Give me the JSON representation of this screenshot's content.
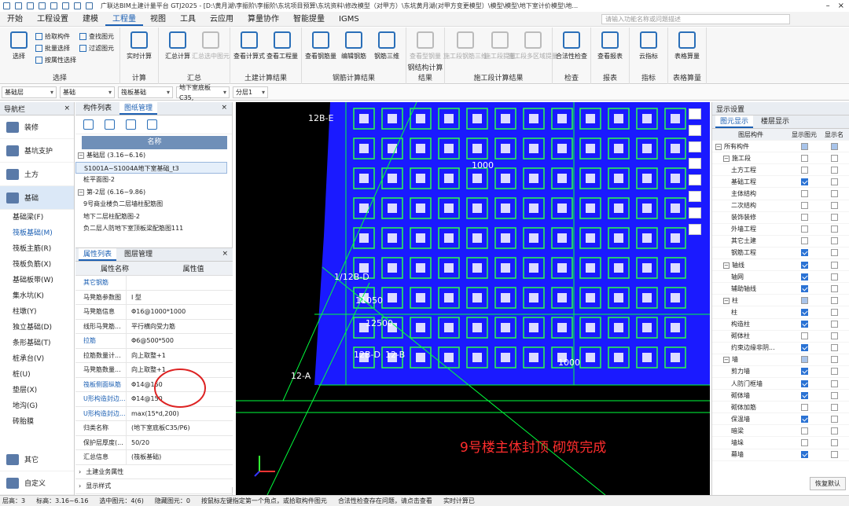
{
  "app": {
    "title": "广联达BIM土建计量平台 GTJ2025 - [D:\\黄月湖\\李振阶\\李振阶\\东坑项目预算\\东坑资料\\修改模型（对甲方）\\东坑黄月湖(对甲方变更模型）\\模型\\模型\\地下室计价模型\\地..."
  },
  "menu": [
    "开始",
    "工程设置",
    "建模",
    "工程量",
    "视图",
    "工具",
    "云应用",
    "算量协作",
    "智能提量",
    "IGMS"
  ],
  "search_placeholder": "请输入功能名称或问题描述",
  "ribbon": {
    "groups": [
      {
        "label": "选择",
        "big": [
          "选择"
        ],
        "small": [
          [
            "拾取构件",
            "批量选择",
            "按属性选择"
          ],
          [
            "查找图元",
            "过滤图元"
          ]
        ]
      },
      {
        "label": "计算",
        "big": [
          "实时计算"
        ]
      },
      {
        "label": "汇总",
        "big": [
          "汇总计算",
          "汇总选中图元"
        ],
        "dis": [
          false,
          true
        ]
      },
      {
        "label": "土建计算结果",
        "big": [
          "查看计算式",
          "查看工程量"
        ]
      },
      {
        "label": "钢筋计算结果",
        "big": [
          "查看钢筋量",
          "编辑钢筋",
          "钢筋三维"
        ]
      },
      {
        "label": "钢结构计算结果",
        "big": [
          "查看型钢量"
        ],
        "dis": [
          true
        ]
      },
      {
        "label": "施工段计算结果",
        "big": [
          "施工段钢筋三维",
          "施工段提量",
          "施工段多区域提量"
        ],
        "dis": [
          true,
          true,
          true
        ]
      },
      {
        "label": "检查",
        "big": [
          "合法性检查"
        ]
      },
      {
        "label": "报表",
        "big": [
          "查看报表"
        ]
      },
      {
        "label": "指标",
        "big": [
          "云指标"
        ]
      },
      {
        "label": "表格算量",
        "big": [
          "表格算量"
        ]
      }
    ]
  },
  "toolbar2": [
    "基础层",
    "基础",
    "筏板基础",
    "地下室底板C35,",
    "分层1"
  ],
  "nav": {
    "title": "导航栏",
    "cats": [
      "装修",
      "基坑支护",
      "土方",
      "基础"
    ],
    "subs": [
      "基础梁(F)",
      "筏板基础(M)",
      "筏板主筋(R)",
      "筏板负筋(X)",
      "基础板带(W)",
      "集水坑(K)",
      "柱墩(Y)",
      "独立基础(D)",
      "条形基础(T)",
      "桩承台(V)",
      "桩(U)",
      "垫层(X)",
      "地沟(G)",
      "砖胎膜"
    ],
    "bottom": [
      "其它",
      "自定义"
    ]
  },
  "drawing": {
    "tabs": [
      "构件列表",
      "图纸管理"
    ],
    "col": "名称",
    "rows": [
      {
        "t": "基础层 (3.16~6.16)",
        "g": true
      },
      {
        "t": "S1001A~S1004A地下室基础_t3",
        "sel": true
      },
      {
        "t": "桩平面图-2"
      },
      {
        "t": "第-2层 (6.16~9.86)",
        "g": true
      },
      {
        "t": "9号商业楼负二层墙柱配筋图"
      },
      {
        "t": "地下二层柱配筋图-2"
      },
      {
        "t": "负二层人防地下室顶板梁配筋图111"
      }
    ]
  },
  "props": {
    "tabs": [
      "属性列表",
      "图层管理"
    ],
    "hdr": [
      "属性名称",
      "属性值"
    ],
    "rows": [
      {
        "n": "其它钢筋",
        "v": "",
        "l": true
      },
      {
        "n": "马凳筋参数图",
        "v": "I 型"
      },
      {
        "n": "马凳筋信息",
        "v": "Φ16@1000*1000"
      },
      {
        "n": "线形马凳筋...",
        "v": "平行横向受力筋"
      },
      {
        "n": "拉筋",
        "v": "Φ6@500*500",
        "l": true
      },
      {
        "n": "拉筋数量计...",
        "v": "向上取整+1"
      },
      {
        "n": "马凳筋数量...",
        "v": "向上取整+1"
      },
      {
        "n": "筏板侧面纵筋",
        "v": "Φ14@150",
        "l": true
      },
      {
        "n": "U形构造封边...",
        "v": "Φ14@150",
        "l": true
      },
      {
        "n": "U形构造封边...",
        "v": "max(15*d,200)",
        "l": true
      },
      {
        "n": "归类名称",
        "v": "(地下室底板C35/P6)"
      },
      {
        "n": "保护层厚度(...",
        "v": "50/20"
      },
      {
        "n": "汇总信息",
        "v": "(筏板基础)"
      }
    ],
    "foot": [
      "土建业务属性",
      "显示样式"
    ]
  },
  "cad": {
    "labels": [
      "12B-E",
      "1/12B-D",
      "12B-D",
      "12-A",
      "12-B",
      "1000",
      "1000",
      "11050",
      "12500",
      "9号楼主体封顶  砌筑完成"
    ]
  },
  "display": {
    "title": "显示设置",
    "tabs": [
      "图元显示",
      "楼层显示"
    ],
    "hdr": [
      "图层构件",
      "显示图元",
      "显示名"
    ],
    "rows": [
      {
        "n": "所有构件",
        "lv": 0,
        "tg": "−",
        "a": "p",
        "b": "p"
      },
      {
        "n": "施工段",
        "lv": 1,
        "tg": "−",
        "a": "n",
        "b": "n"
      },
      {
        "n": "土方工程",
        "lv": 2,
        "a": "n",
        "b": "n"
      },
      {
        "n": "基础工程",
        "lv": 2,
        "a": "y",
        "b": "n"
      },
      {
        "n": "主体结构",
        "lv": 2,
        "a": "n",
        "b": "n"
      },
      {
        "n": "二次结构",
        "lv": 2,
        "a": "n",
        "b": "n"
      },
      {
        "n": "装饰装修",
        "lv": 2,
        "a": "n",
        "b": "n"
      },
      {
        "n": "外墙工程",
        "lv": 2,
        "a": "n",
        "b": "n"
      },
      {
        "n": "其它土建",
        "lv": 2,
        "a": "n",
        "b": "n"
      },
      {
        "n": "钢筋工程",
        "lv": 2,
        "a": "y",
        "b": "n"
      },
      {
        "n": "轴线",
        "lv": 1,
        "tg": "−",
        "a": "y",
        "b": "n"
      },
      {
        "n": "轴网",
        "lv": 2,
        "a": "y",
        "b": "n"
      },
      {
        "n": "辅助轴线",
        "lv": 2,
        "a": "y",
        "b": "n"
      },
      {
        "n": "柱",
        "lv": 1,
        "tg": "−",
        "a": "p",
        "b": "n"
      },
      {
        "n": "柱",
        "lv": 2,
        "a": "y",
        "b": "n"
      },
      {
        "n": "构造柱",
        "lv": 2,
        "a": "y",
        "b": "n"
      },
      {
        "n": "砌体柱",
        "lv": 2,
        "a": "n",
        "b": "n"
      },
      {
        "n": "约束边缘非阴...",
        "lv": 2,
        "a": "y",
        "b": "n"
      },
      {
        "n": "墙",
        "lv": 1,
        "tg": "−",
        "a": "p",
        "b": "n"
      },
      {
        "n": "剪力墙",
        "lv": 2,
        "a": "y",
        "b": "n"
      },
      {
        "n": "人防门框墙",
        "lv": 2,
        "a": "y",
        "b": "n"
      },
      {
        "n": "砌体墙",
        "lv": 2,
        "a": "y",
        "b": "n"
      },
      {
        "n": "砌体加筋",
        "lv": 2,
        "a": "n",
        "b": "n"
      },
      {
        "n": "保温墙",
        "lv": 2,
        "a": "y",
        "b": "n"
      },
      {
        "n": "暗梁",
        "lv": 2,
        "a": "n",
        "b": "n"
      },
      {
        "n": "墙垛",
        "lv": 2,
        "a": "n",
        "b": "n"
      },
      {
        "n": "幕墙",
        "lv": 2,
        "a": "y",
        "b": "n"
      }
    ],
    "restore": "恢复默认"
  },
  "status": [
    "层高：3",
    "标高：3.16~6.16",
    "选中图元：4(6)",
    "隐藏图元：0",
    "按鼠标左键指定第一个角点，或拾取构件图元",
    "合法性检查存在问题，请点击查看",
    "实时计算已"
  ]
}
